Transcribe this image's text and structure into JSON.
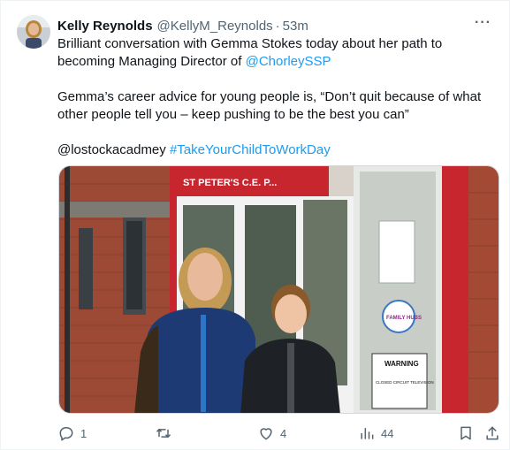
{
  "author": {
    "name": "Kelly Reynolds",
    "handle": "@KellyM_Reynolds",
    "separator": "·",
    "time": "53m"
  },
  "more_label": "···",
  "tweet": {
    "line1": "Brilliant conversation with Gemma Stokes today about her path to",
    "line2_text": "becoming Managing Director of ",
    "line2_mention": "@ChorleySSP",
    "quote_line1": "Gemma’s career advice for young people is, “Don’t quit because of what",
    "quote_line2": "other people tell you – keep pushing to be the best you can”",
    "mention_plain": "@lostockacadmey",
    "hashtag": "#TakeYourChildToWorkDay"
  },
  "photo": {
    "sign_text": "ST PETER'S C.E. P...",
    "poster_text": "FAMILY HUBS",
    "warning_title": "WARNING",
    "warning_sub": "CLOSED CIRCUIT TELEVISION"
  },
  "actions": {
    "replies": "1",
    "reposts": "",
    "likes": "4",
    "views": "44"
  },
  "colors": {
    "link": "#1d9bf0",
    "muted": "#536471",
    "text": "#0f1419"
  }
}
